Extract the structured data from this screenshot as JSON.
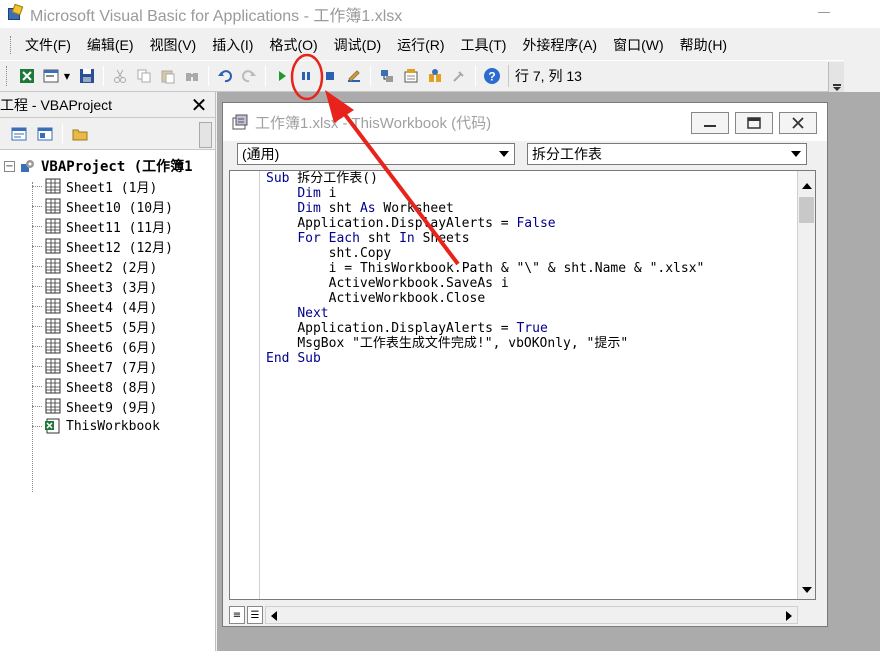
{
  "window": {
    "title": "Microsoft Visual Basic for Applications - 工作簿1.xlsx"
  },
  "menu": {
    "items": [
      "文件(F)",
      "编辑(E)",
      "视图(V)",
      "插入(I)",
      "格式(O)",
      "调试(D)",
      "运行(R)",
      "工具(T)",
      "外接程序(A)",
      "窗口(W)",
      "帮助(H)"
    ]
  },
  "toolbar": {
    "status": "行 7, 列 13",
    "run_color": "#1e9a2d",
    "help_color": "#2d6bd0"
  },
  "project": {
    "title": "工程 - VBAProject",
    "close_glyph": "✕",
    "root": "VBAProject (工作簿1",
    "items": [
      "Sheet1 (1月)",
      "Sheet10 (10月)",
      "Sheet11 (11月)",
      "Sheet12 (12月)",
      "Sheet2 (2月)",
      "Sheet3 (3月)",
      "Sheet4 (4月)",
      "Sheet5 (5月)",
      "Sheet6 (6月)",
      "Sheet7 (7月)",
      "Sheet8 (8月)",
      "Sheet9 (9月)",
      "ThisWorkbook"
    ]
  },
  "code_window": {
    "title": "工作簿1.xlsx - ThisWorkbook (代码)",
    "object_combo": "(通用)",
    "procedure_combo": "拆分工作表",
    "lines": [
      "Sub 拆分工作表()",
      "    Dim i",
      "    Dim sht As Worksheet",
      "    Application.DisplayAlerts = False",
      "    For Each sht In Sheets",
      "        sht.Copy",
      "        i = ThisWorkbook.Path & \"\\\" & sht.Name & \".xlsx\"",
      "        ActiveWorkbook.SaveAs i",
      "        ActiveWorkbook.Close",
      "    Next",
      "    Application.DisplayAlerts = True",
      "    MsgBox \"工作表生成文件完成!\", vbOKOnly, \"提示\"",
      "End Sub"
    ]
  },
  "annotation": {
    "color": "#e8231b"
  }
}
